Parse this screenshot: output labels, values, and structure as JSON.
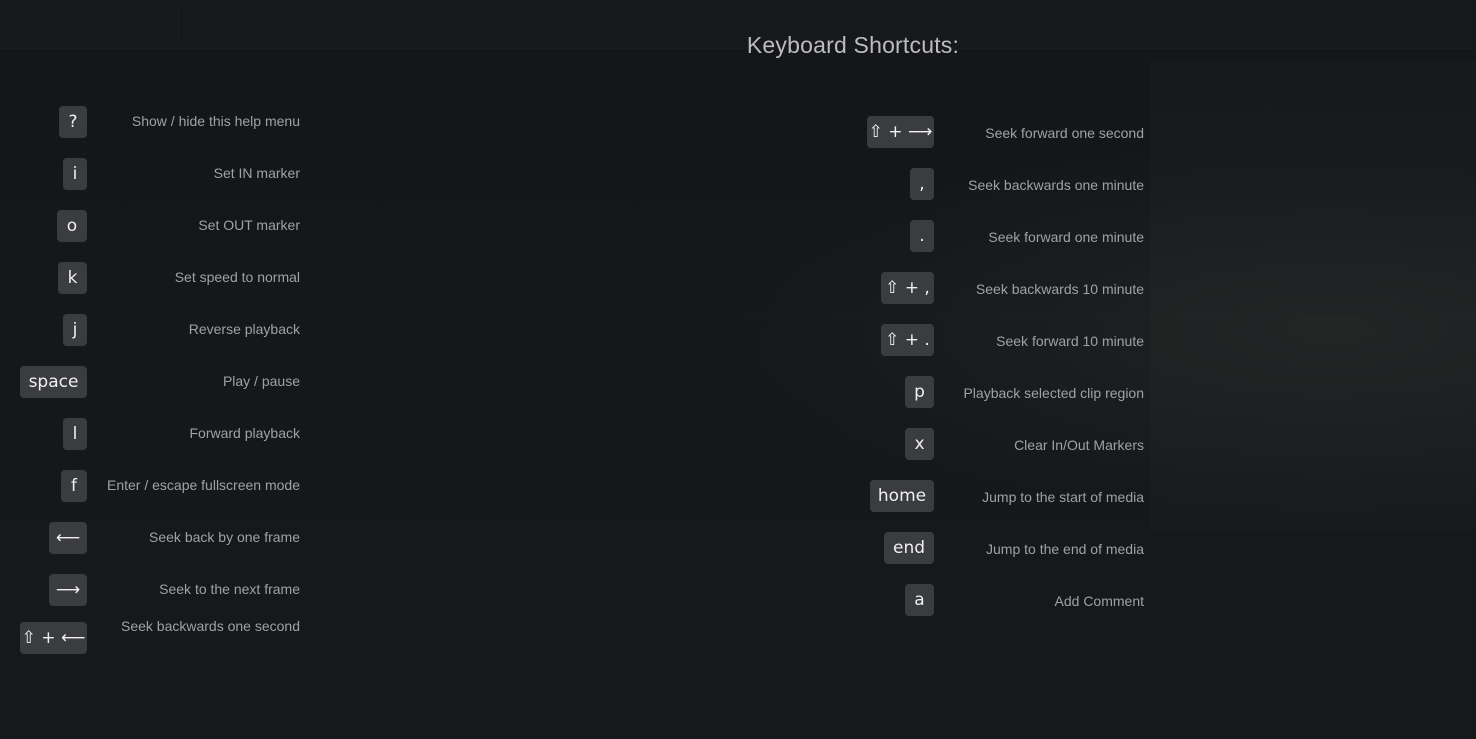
{
  "title": "Keyboard Shortcuts:",
  "left_column": [
    {
      "key": "?",
      "description": "Show / hide this help menu"
    },
    {
      "key": "i",
      "description": "Set IN marker"
    },
    {
      "key": "o",
      "description": "Set OUT marker"
    },
    {
      "key": "k",
      "description": "Set speed to normal"
    },
    {
      "key": "j",
      "description": "Reverse playback"
    },
    {
      "key": "space",
      "description": "Play / pause"
    },
    {
      "key": "l",
      "description": "Forward playback"
    },
    {
      "key": "f",
      "description": "Enter / escape fullscreen mode"
    },
    {
      "key": "⟵",
      "description": "Seek back by one frame"
    },
    {
      "key": "⟶",
      "description": "Seek to the next frame"
    },
    {
      "key": "⇧ + ⟵",
      "description": "Seek backwards one second"
    }
  ],
  "right_column": [
    {
      "key": "⇧ + ⟶",
      "description": "Seek forward one second"
    },
    {
      "key": ",",
      "description": "Seek backwards one minute"
    },
    {
      "key": ".",
      "description": "Seek forward one minute"
    },
    {
      "key": "⇧ + ,",
      "description": "Seek backwards 10 minute"
    },
    {
      "key": "⇧ + .",
      "description": "Seek forward 10 minute"
    },
    {
      "key": "p",
      "description": "Playback selected clip region"
    },
    {
      "key": "x",
      "description": "Clear In/Out Markers"
    },
    {
      "key": "home",
      "description": "Jump to the start of media"
    },
    {
      "key": "end",
      "description": "Jump to the end of media"
    },
    {
      "key": "a",
      "description": "Add Comment"
    }
  ],
  "colors": {
    "background": "#16181b",
    "key_background": "#3b3c40",
    "key_text": "#f0f0f2",
    "description_text": "#9fa1a6",
    "title_text": "#bdbdbf"
  }
}
